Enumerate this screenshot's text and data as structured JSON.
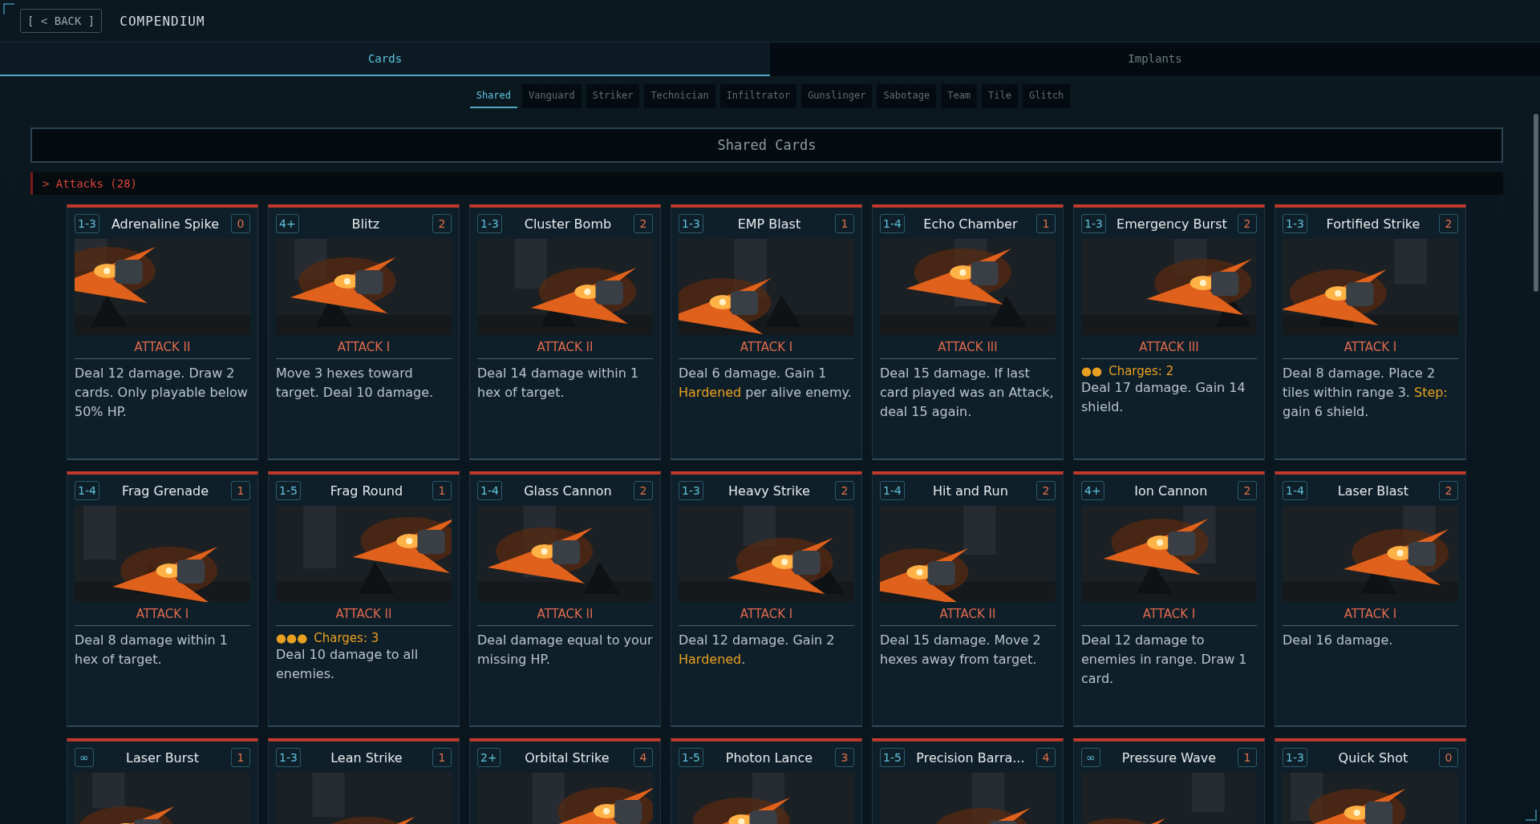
{
  "header": {
    "back_button": "[ < BACK ]",
    "title": "COMPENDIUM"
  },
  "tabs": [
    {
      "label": "Cards",
      "selected": true
    },
    {
      "label": "Implants",
      "selected": false
    }
  ],
  "subtabs": [
    {
      "label": "Shared",
      "selected": true
    },
    {
      "label": "Vanguard",
      "selected": false
    },
    {
      "label": "Striker",
      "selected": false
    },
    {
      "label": "Technician",
      "selected": false
    },
    {
      "label": "Infiltrator",
      "selected": false
    },
    {
      "label": "Gunslinger",
      "selected": false
    },
    {
      "label": "Sabotage",
      "selected": false
    },
    {
      "label": "Team",
      "selected": false
    },
    {
      "label": "Tile",
      "selected": false
    },
    {
      "label": "Glitch",
      "selected": false
    }
  ],
  "section_title": "Shared Cards",
  "group": {
    "label": "> Attacks (28)"
  },
  "cards": [
    {
      "range": "1-3",
      "name": "Adrenaline Spike",
      "cost": "0",
      "type": "ATTACK II",
      "description": "Deal 12 damage. Draw 2 cards. Only playable below 50% HP."
    },
    {
      "range": "4+",
      "name": "Blitz",
      "cost": "2",
      "type": "ATTACK I",
      "description": "Move 3 hexes toward target. Deal 10 damage."
    },
    {
      "range": "1-3",
      "name": "Cluster Bomb",
      "cost": "2",
      "type": "ATTACK II",
      "description": "Deal 14 damage within 1 hex of target."
    },
    {
      "range": "1-3",
      "name": "EMP Blast",
      "cost": "1",
      "type": "ATTACK I",
      "description": "Deal 6 damage. Gain 1 **Hardened** per alive enemy."
    },
    {
      "range": "1-4",
      "name": "Echo Chamber",
      "cost": "1",
      "type": "ATTACK III",
      "description": "Deal 15 damage. If last card played was an Attack, deal 15 again."
    },
    {
      "range": "1-3",
      "name": "Emergency Burst",
      "cost": "2",
      "type": "ATTACK III",
      "charges": {
        "dots": "●●",
        "label": "Charges: 2"
      },
      "description": "Deal 17 damage. Gain 14 shield."
    },
    {
      "range": "1-3",
      "name": "Fortified Strike",
      "cost": "2",
      "type": "ATTACK I",
      "description": "Deal 8 damage. Place 2 tiles within range 3. **Step:** gain 6 shield."
    },
    {
      "range": "1-4",
      "name": "Frag Grenade",
      "cost": "1",
      "type": "ATTACK I",
      "description": "Deal 8 damage within 1 hex of target."
    },
    {
      "range": "1-5",
      "name": "Frag Round",
      "cost": "1",
      "type": "ATTACK II",
      "charges": {
        "dots": "●●●",
        "label": "Charges: 3"
      },
      "description": "Deal 10 damage to all enemies."
    },
    {
      "range": "1-4",
      "name": "Glass Cannon",
      "cost": "2",
      "type": "ATTACK II",
      "description": "Deal damage equal to your missing HP."
    },
    {
      "range": "1-3",
      "name": "Heavy Strike",
      "cost": "2",
      "type": "ATTACK I",
      "description": "Deal 12 damage. Gain 2 **Hardened**."
    },
    {
      "range": "1-4",
      "name": "Hit and Run",
      "cost": "2",
      "type": "ATTACK II",
      "description": "Deal 15 damage. Move 2 hexes away from target."
    },
    {
      "range": "4+",
      "name": "Ion Cannon",
      "cost": "2",
      "type": "ATTACK I",
      "description": "Deal 12 damage to enemies in range. Draw 1 card."
    },
    {
      "range": "1-4",
      "name": "Laser Blast",
      "cost": "2",
      "type": "ATTACK I",
      "description": "Deal 16 damage."
    },
    {
      "range": "∞",
      "name": "Laser Burst",
      "cost": "1"
    },
    {
      "range": "1-3",
      "name": "Lean Strike",
      "cost": "1"
    },
    {
      "range": "2+",
      "name": "Orbital Strike",
      "cost": "4"
    },
    {
      "range": "1-5",
      "name": "Photon Lance",
      "cost": "3"
    },
    {
      "range": "1-5",
      "name": "Precision Barra...",
      "cost": "4"
    },
    {
      "range": "∞",
      "name": "Pressure Wave",
      "cost": "1"
    },
    {
      "range": "1-3",
      "name": "Quick Shot",
      "cost": "0"
    }
  ]
}
